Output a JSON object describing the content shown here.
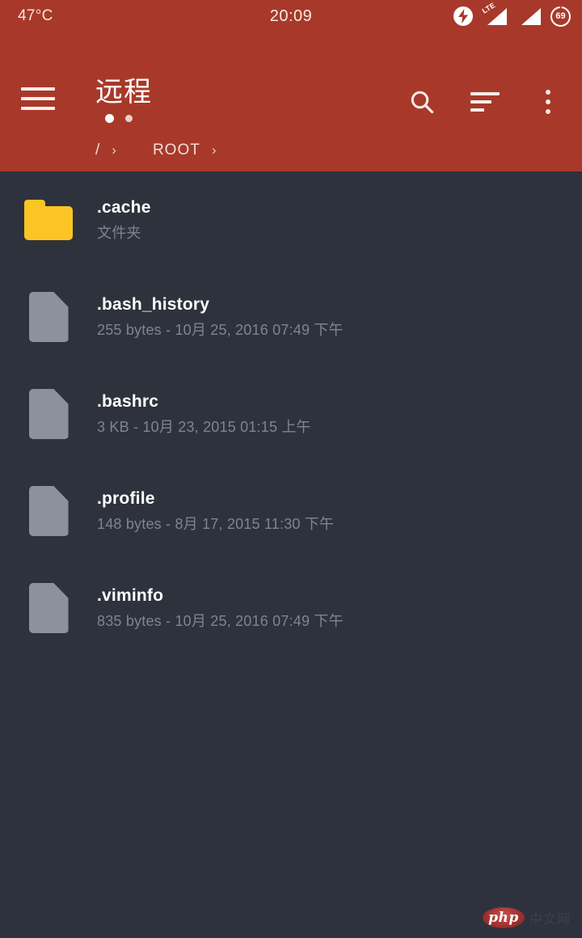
{
  "statusbar": {
    "temperature": "47°C",
    "clock": "20:09",
    "network_label": "LTE",
    "battery_level": "69",
    "icons": [
      "flash-circle-icon",
      "lte-signal-icon",
      "signal-icon",
      "battery-circle-icon"
    ]
  },
  "appbar": {
    "menu_icon": "hamburger-menu-icon",
    "title": "远程",
    "page_dots": 2,
    "actions": [
      {
        "name": "search",
        "icon": "search-icon"
      },
      {
        "name": "sort",
        "icon": "sort-icon"
      },
      {
        "name": "overflow",
        "icon": "more-vertical-icon"
      }
    ],
    "accent_color": "#a8392a"
  },
  "breadcrumb": {
    "root": "/",
    "separator": "›",
    "current": "ROOT",
    "trailing_separator": "›"
  },
  "files": [
    {
      "name": ".cache",
      "subtitle": "文件夹",
      "type": "folder",
      "icon": "folder-icon"
    },
    {
      "name": ".bash_history",
      "subtitle": "255 bytes  -  10月 25, 2016  07:49 下午",
      "type": "file",
      "icon": "file-icon"
    },
    {
      "name": ".bashrc",
      "subtitle": "3 KB  -  10月 23, 2015  01:15 上午",
      "type": "file",
      "icon": "file-icon"
    },
    {
      "name": ".profile",
      "subtitle": "148 bytes  -  8月 17, 2015  11:30 下午",
      "type": "file",
      "icon": "file-icon"
    },
    {
      "name": ".viminfo",
      "subtitle": "835 bytes  -  10月 25, 2016  07:49 下午",
      "type": "file",
      "icon": "file-icon"
    }
  ],
  "theme": {
    "background": "#2e323c",
    "header": "#a8392a",
    "folder_color": "#fbc524",
    "file_color": "#8c919c",
    "subtitle_color": "#7f848f"
  },
  "watermark": {
    "logo_text": "php",
    "site_text": "中文网"
  }
}
